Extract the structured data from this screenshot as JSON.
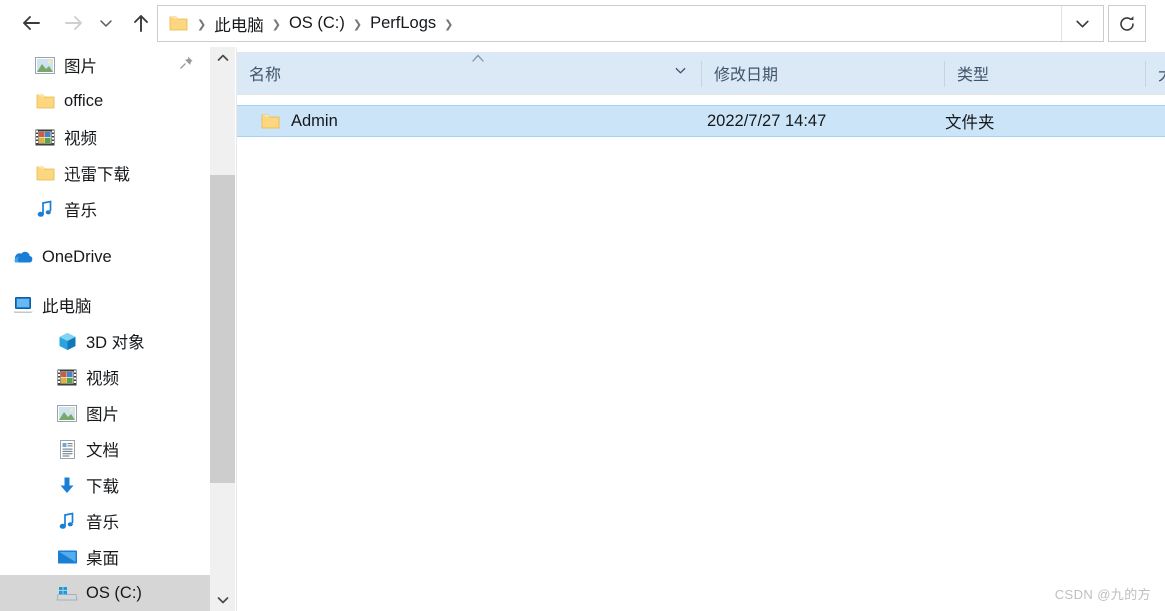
{
  "window": {
    "title": "PerfLogs"
  },
  "nav": {
    "back": "←",
    "forward": "→",
    "recent": "⌄",
    "up": "↑",
    "refresh": "↻",
    "address_dropdown": "⌄"
  },
  "breadcrumb": {
    "items": [
      "此电脑",
      "OS (C:)",
      "PerfLogs"
    ],
    "separator": "❯",
    "trailing_separator": "❯"
  },
  "sidebar": {
    "quick_access": [
      {
        "label": "图片",
        "icon": "pictures-icon",
        "pinned": true
      },
      {
        "label": "office",
        "icon": "folder-icon",
        "pinned": false
      },
      {
        "label": "视频",
        "icon": "videos-icon",
        "pinned": false
      },
      {
        "label": "迅雷下载",
        "icon": "folder-icon",
        "pinned": false
      },
      {
        "label": "音乐",
        "icon": "music-icon",
        "pinned": false
      }
    ],
    "onedrive": {
      "label": "OneDrive",
      "icon": "onedrive-cloud-icon"
    },
    "this_pc": {
      "label": "此电脑",
      "icon": "computer-icon"
    },
    "this_pc_children": [
      {
        "label": "3D 对象",
        "icon": "3d-objects-icon"
      },
      {
        "label": "视频",
        "icon": "videos-icon"
      },
      {
        "label": "图片",
        "icon": "pictures-icon"
      },
      {
        "label": "文档",
        "icon": "documents-icon"
      },
      {
        "label": "下载",
        "icon": "downloads-icon"
      },
      {
        "label": "音乐",
        "icon": "music-icon"
      },
      {
        "label": "桌面",
        "icon": "desktop-icon"
      },
      {
        "label": "OS (C:)",
        "icon": "drive-icon",
        "selected": true
      }
    ],
    "scroll_up": "⌃",
    "scroll_down": "⌄"
  },
  "columns": [
    {
      "label": "名称",
      "sorted": true,
      "sort_direction": "asc",
      "sort_caret": "⌃",
      "filter_chevron": "⌄"
    },
    {
      "label": "修改日期",
      "sorted": false
    },
    {
      "label": "类型",
      "sorted": false
    },
    {
      "label": "大小",
      "sorted": false
    }
  ],
  "files": [
    {
      "name": "Admin",
      "icon": "folder-icon",
      "modified": "2022/7/27 14:47",
      "type": "文件夹",
      "size": "",
      "selected": true
    }
  ],
  "watermark": "CSDN @九的方",
  "colors": {
    "header_blue": "#dbe8f6",
    "selection_blue": "#cce4f7",
    "selection_border": "#a8d3f0",
    "sidebar_selected": "#d6d6d6",
    "folder_yellow": "#fcd77f",
    "accent_blue": "#0078d7",
    "text": "#16191c"
  }
}
